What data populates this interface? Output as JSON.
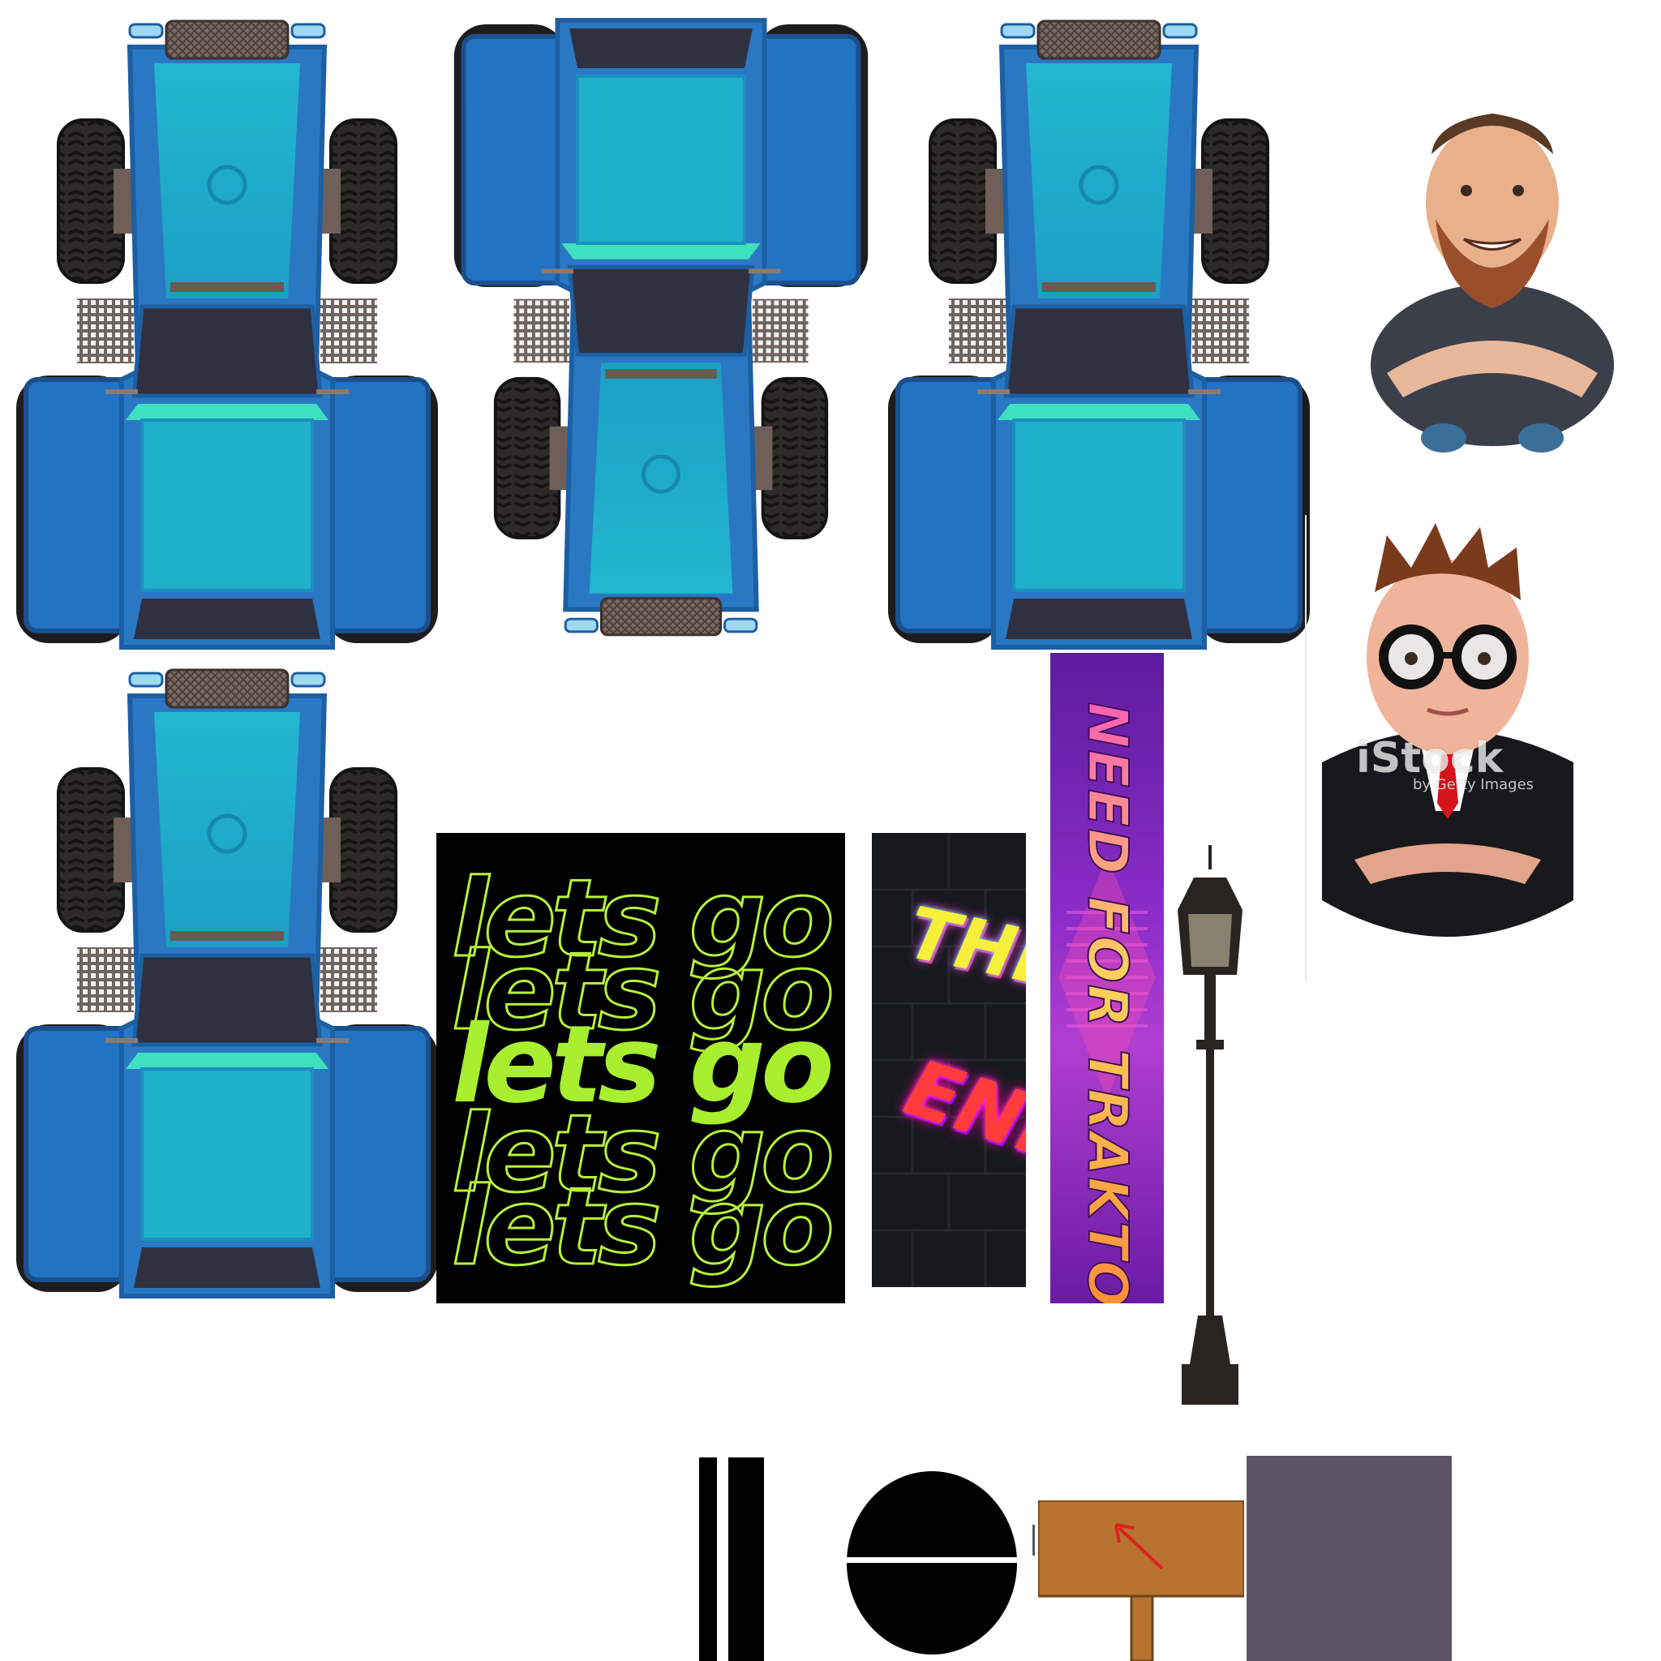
{
  "sheet": {
    "background": "#ffffff"
  },
  "tractor": {
    "colors": {
      "body": "#2480c8",
      "body_dark": "#1c5fa3",
      "hood": "#1fb0cc",
      "accent": "#3fe0c0",
      "window": "#2f3140",
      "tire": "#2b2b2b",
      "tire_edge": "#141414",
      "grille": "#7a6a62"
    }
  },
  "posters": {
    "lets_go": {
      "text": "lets go",
      "color": "#a7ef2f",
      "background": "#000000"
    },
    "the_end": {
      "word1": "THE",
      "word2": "END",
      "background": "#16191e"
    },
    "need_for_traktor": {
      "text": "NEED FOR TRAKTOR"
    }
  },
  "people": {
    "watermark": {
      "brand": "iStock",
      "byline": "by Getty Images"
    }
  },
  "props": {
    "lamp_post": {
      "color": "#2a2420"
    },
    "sign": {
      "color": "#b87330",
      "arrow_color": "#e02020"
    },
    "swatch": {
      "color": "#5d5565"
    }
  }
}
